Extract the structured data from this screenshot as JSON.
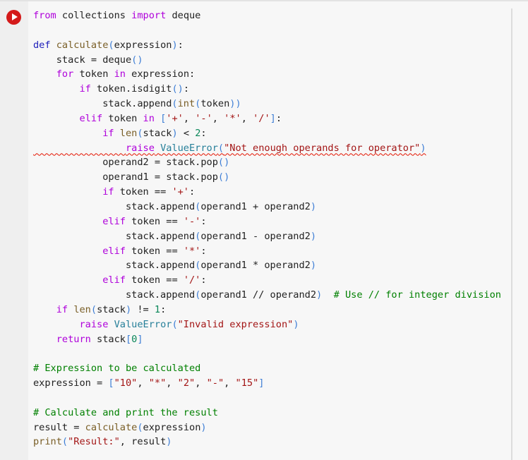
{
  "cell": {
    "run_button_label": "Run cell",
    "language": "python",
    "lines": [
      "from collections import deque",
      "",
      "def calculate(expression):",
      "    stack = deque()",
      "    for token in expression:",
      "        if token.isdigit():",
      "            stack.append(int(token))",
      "        elif token in ['+', '-', '*', '/']:",
      "            if len(stack) < 2:",
      "                raise ValueError(\"Not enough operands for operator\")",
      "            operand2 = stack.pop()",
      "            operand1 = stack.pop()",
      "            if token == '+':",
      "                stack.append(operand1 + operand2)",
      "            elif token == '-':",
      "                stack.append(operand1 - operand2)",
      "            elif token == '*':",
      "                stack.append(operand1 * operand2)",
      "            elif token == '/':",
      "                stack.append(operand1 // operand2)  # Use // for integer division",
      "    if len(stack) != 1:",
      "        raise ValueError(\"Invalid expression\")",
      "    return stack[0]",
      "",
      "# Expression to be calculated",
      "expression = [\"10\", \"*\", \"2\", \"-\", \"15\"]",
      "",
      "# Calculate and print the result",
      "result = calculate(expression)",
      "print(\"Result:\", result)"
    ],
    "error_line_index": 9
  },
  "colors": {
    "run_button": "#d41a1a",
    "keyword": "#af00db",
    "def_keyword": "#1d1dba",
    "function": "#795e26",
    "class": "#267f99",
    "string": "#a31515",
    "number": "#098658",
    "comment": "#008000",
    "error_underline": "#e51400"
  }
}
